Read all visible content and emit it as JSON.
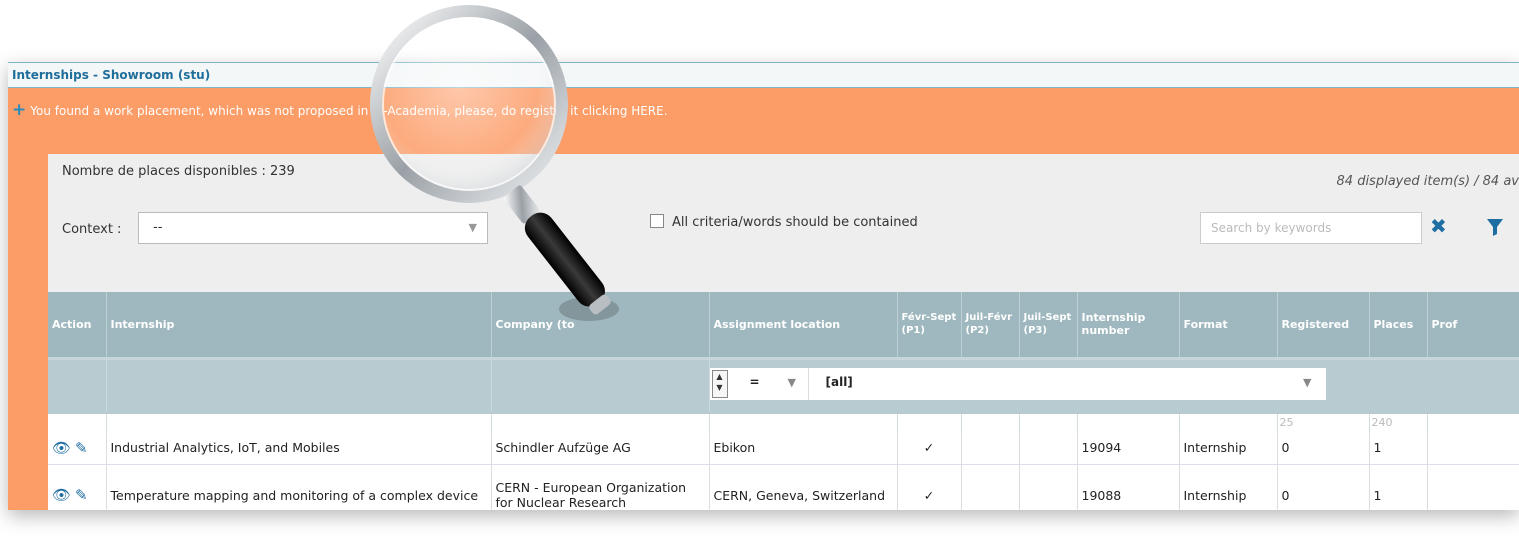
{
  "window": {
    "title": "Internships - Showroom (stu)"
  },
  "banner": {
    "register_text": "You found a work placement, which was not proposed in IS-Academia, please, do register it clicking HERE."
  },
  "panel": {
    "places_available": "Nombre de places disponibles : 239",
    "displayed_count": "84 displayed item(s) / 84 av",
    "context_label": "Context :",
    "context_value": "--",
    "criteria_label": "All criteria/words should be contained",
    "search_placeholder": "Search by keywords"
  },
  "table": {
    "headers": {
      "action": "Action",
      "internship": "Internship",
      "company": "Company (to",
      "location": "Assignment location",
      "p1": "Févr-Sept (P1)",
      "p2": "Juil-Févr (P2)",
      "p3": "Juil-Sept (P3)",
      "number": "Internship number",
      "format": "Format",
      "registered": "Registered",
      "places": "Places",
      "prof": "Prof"
    },
    "filter": {
      "operator": "=",
      "value": "[all]"
    },
    "subrow": {
      "registered": "25",
      "places": "240"
    },
    "rows": [
      {
        "internship": "Industrial Analytics, IoT, and Mobiles",
        "company": "Schindler Aufzüge AG",
        "location": "Ebikon",
        "p1": "✓",
        "number": "19094",
        "format": "Internship",
        "registered": "0",
        "places": "1"
      },
      {
        "internship": "Temperature mapping and monitoring of a complex device",
        "company": "CERN - European Organization for Nuclear Research",
        "location": "CERN, Geneva, Switzerland",
        "p1": "✓",
        "number": "19088",
        "format": "Internship",
        "registered": "0",
        "places": "1"
      }
    ]
  },
  "colors": {
    "accent": "#fc9c67",
    "header": "#9fb8bf",
    "link": "#1f6e9b"
  }
}
